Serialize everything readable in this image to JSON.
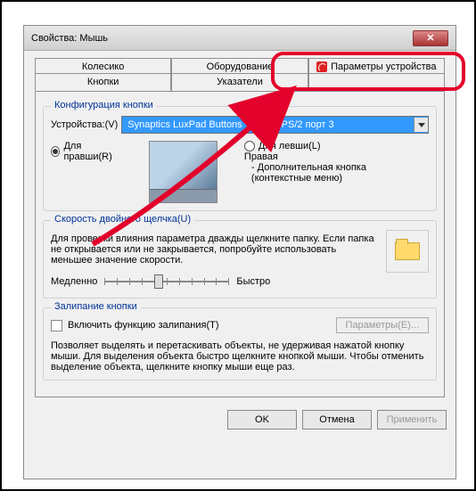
{
  "window": {
    "title": "Свойства: Мышь"
  },
  "tabs": {
    "back": [
      "Колесико",
      "Оборудование",
      "Параметры устройства"
    ],
    "front": [
      "Кнопки",
      "Указатели",
      ""
    ]
  },
  "config_group": {
    "title": "Конфигурация кнопки",
    "device_label": "Устройства:(V)",
    "device_value": "Synaptics LuxPad Buttons V7.5 на PS/2 порт 3",
    "radio_right": "Для правши(R)",
    "radio_left": "Для левши(L)",
    "right_label": "Правая",
    "right_sub": "- Дополнительная кнопка (контекстные меню)"
  },
  "speed_group": {
    "title": "Скорость двойного щелчка(U)",
    "help": "Для проверки влияния параметра дважды щелкните папку. Если папка не открывается или не закрывается, попробуйте использовать меньшее значение скорости.",
    "slow": "Медленно",
    "fast": "Быстро"
  },
  "sticky_group": {
    "title": "Залипание кнопки",
    "checkbox": "Включить функцию залипания(T)",
    "params_btn": "Параметры(E)...",
    "help": "Позволяет выделять и перетаскивать объекты, не удерживая нажатой кнопку мыши. Для выделения объекта быстро щелкните кнопкой мыши. Чтобы отменить выделение объекта, щелкните кнопку мыши еще раз."
  },
  "buttons": {
    "ok": "OK",
    "cancel": "Отмена",
    "apply": "Применить"
  }
}
